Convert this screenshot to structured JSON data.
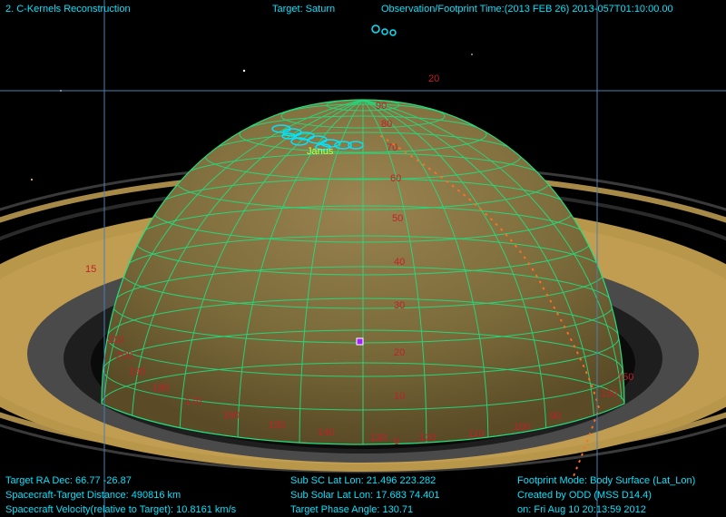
{
  "window": {
    "title": "2. C-Kernels Reconstruction",
    "target": "Target: Saturn",
    "observation_time": "Observation/Footprint Time:(2013 FEB 26) 2013-057T01:10:00.00"
  },
  "bottom_left": {
    "ra_dec": "Target RA Dec: 66.77  -26.87",
    "distance": "Spacecraft-Target Distance:  490816 km",
    "velocity": "Spacecraft Velocity(relative to Target): 10.8161 km/s"
  },
  "bottom_center": {
    "sub_sc": "Sub SC Lat Lon: 21.496  223.282",
    "sub_solar": "Sub Solar Lat Lon: 17.683  74.401",
    "phase": "Target Phase Angle: 130.71"
  },
  "bottom_right": {
    "footprint_mode": "Footprint Mode: Body Surface (Lat_Lon)",
    "created_by": "Created by ODD (MSS D14.4)",
    "created_on": "on: Fri Aug 10 20:13:59 2012"
  },
  "scene": {
    "moon_label": "Janus",
    "lat_labels": [
      "90",
      "80",
      "70",
      "60",
      "50",
      "40",
      "30",
      "20",
      "10",
      "0"
    ],
    "lon_labels": [
      "210",
      "200",
      "190",
      "180",
      "170",
      "160",
      "150",
      "140",
      "130",
      "120",
      "110",
      "100",
      "90"
    ],
    "edge_labels": [
      "150",
      "150",
      "20",
      "15"
    ]
  },
  "colors": {
    "hud_cyan": "#00e5ff",
    "hud_yellow": "#ffe000",
    "grid_green": "#20e080",
    "label_red": "#c0202a",
    "planet_fill": "#7a6a3a",
    "ring_tan": "#b8964a"
  }
}
